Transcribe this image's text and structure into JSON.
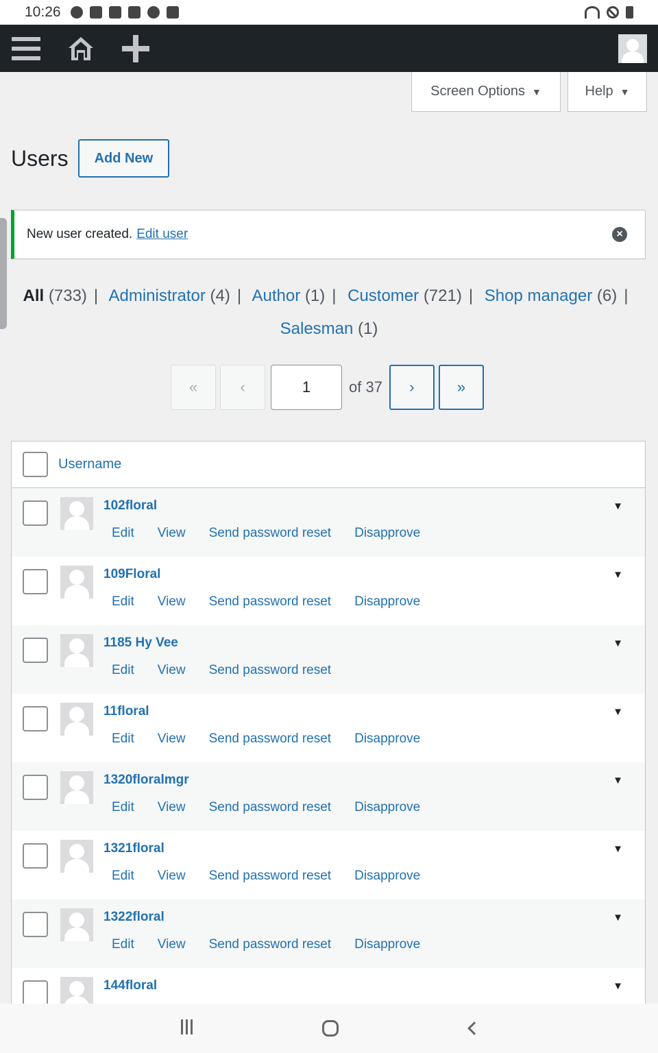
{
  "status_bar": {
    "time": "10:26"
  },
  "admin_bar": {
    "menu_icon": "hamburger-icon",
    "home_icon": "home-icon",
    "new_icon": "plus-icon",
    "avatar_icon": "user-avatar-icon"
  },
  "screen_meta": {
    "screen_options_label": "Screen Options",
    "help_label": "Help"
  },
  "page": {
    "title": "Users",
    "add_new_label": "Add New"
  },
  "notice": {
    "message": "New user created.",
    "link_label": "Edit user"
  },
  "filters": {
    "items": [
      {
        "label": "All",
        "count": "(733)",
        "current": true
      },
      {
        "label": "Administrator",
        "count": "(4)"
      },
      {
        "label": "Author",
        "count": "(1)"
      },
      {
        "label": "Customer",
        "count": "(721)"
      },
      {
        "label": "Shop manager",
        "count": "(6)"
      },
      {
        "label": "Salesman",
        "count": "(1)"
      }
    ],
    "separator": "|"
  },
  "pagination": {
    "first": "«",
    "prev": "‹",
    "current_page": "1",
    "of_label": "of 37",
    "next": "›",
    "last": "»"
  },
  "table": {
    "column_username": "Username",
    "rows": [
      {
        "username": "102floral",
        "actions": [
          "Edit",
          "View",
          "Send password reset",
          "Disapprove"
        ]
      },
      {
        "username": "109Floral",
        "actions": [
          "Edit",
          "View",
          "Send password reset",
          "Disapprove"
        ]
      },
      {
        "username": "1185 Hy Vee",
        "actions": [
          "Edit",
          "View",
          "Send password reset"
        ]
      },
      {
        "username": "11floral",
        "actions": [
          "Edit",
          "View",
          "Send password reset",
          "Disapprove"
        ]
      },
      {
        "username": "1320floralmgr",
        "actions": [
          "Edit",
          "View",
          "Send password reset",
          "Disapprove"
        ]
      },
      {
        "username": "1321floral",
        "actions": [
          "Edit",
          "View",
          "Send password reset",
          "Disapprove"
        ]
      },
      {
        "username": "1322floral",
        "actions": [
          "Edit",
          "View",
          "Send password reset",
          "Disapprove"
        ]
      },
      {
        "username": "144floral",
        "actions": []
      }
    ]
  },
  "nav_bar": {
    "recent_icon": "recent-apps-icon",
    "home_icon": "nav-home-icon",
    "back_icon": "back-icon"
  }
}
